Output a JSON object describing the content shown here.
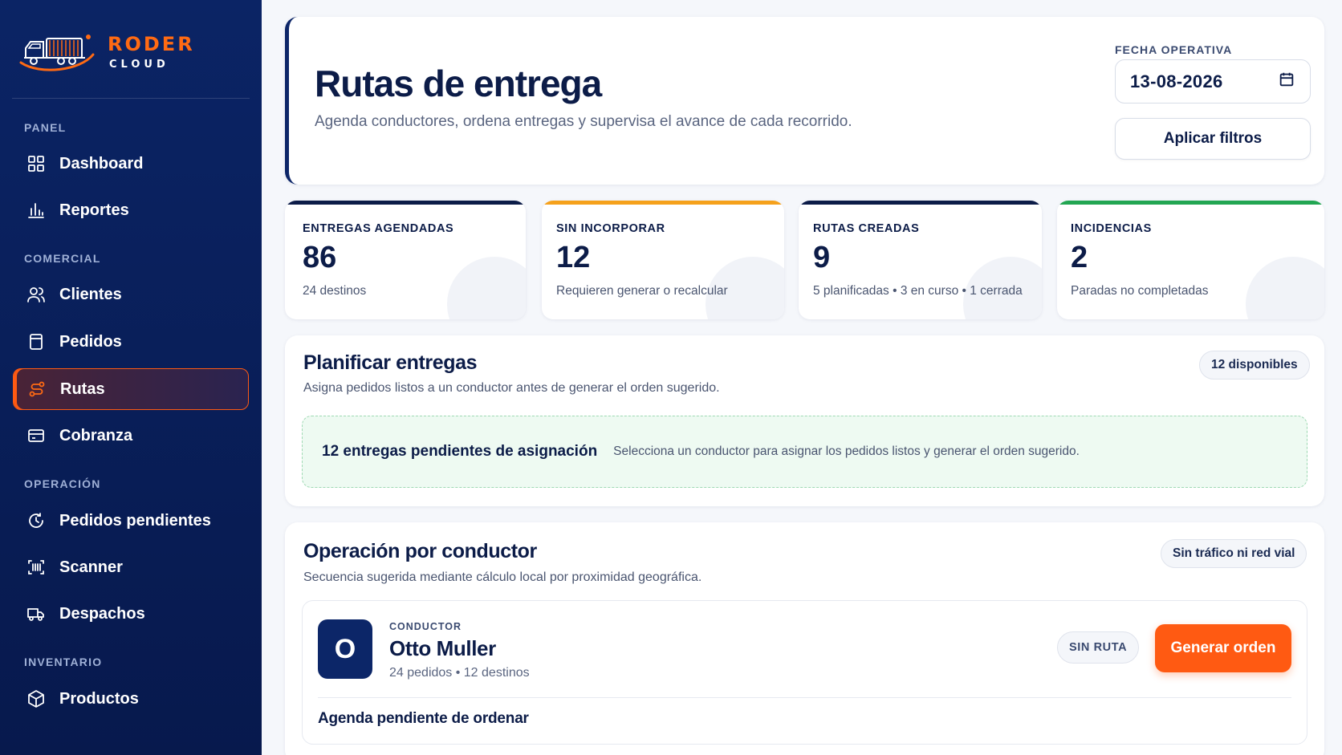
{
  "brand": {
    "name": "RODER",
    "sub": "CLOUD"
  },
  "sidebar": {
    "sections": [
      {
        "label": "PANEL"
      },
      {
        "label": "COMERCIAL"
      },
      {
        "label": "OPERACIÓN"
      },
      {
        "label": "INVENTARIO"
      }
    ],
    "items": [
      {
        "label": "Dashboard",
        "icon": "grid-icon"
      },
      {
        "label": "Reportes",
        "icon": "bar-chart-icon"
      },
      {
        "label": "Clientes",
        "icon": "users-icon"
      },
      {
        "label": "Pedidos",
        "icon": "clipboard-icon"
      },
      {
        "label": "Rutas",
        "icon": "route-icon",
        "active": true
      },
      {
        "label": "Cobranza",
        "icon": "wallet-icon"
      },
      {
        "label": "Pedidos pendientes",
        "icon": "clock-icon"
      },
      {
        "label": "Scanner",
        "icon": "scanner-icon"
      },
      {
        "label": "Despachos",
        "icon": "truck-icon"
      },
      {
        "label": "Productos",
        "icon": "box-icon"
      }
    ]
  },
  "header": {
    "title": "Rutas de entrega",
    "subtitle": "Agenda conductores, ordena entregas y supervisa el avance de cada recorrido.",
    "date_label": "FECHA OPERATIVA",
    "date_value": "13-08-2026",
    "apply_label": "Aplicar filtros"
  },
  "stats": [
    {
      "label": "ENTREGAS AGENDADAS",
      "value": "86",
      "sub": "24 destinos",
      "color": "#0c1c48"
    },
    {
      "label": "SIN INCORPORAR",
      "value": "12",
      "sub": "Requieren generar o recalcular",
      "color": "#f5a11c"
    },
    {
      "label": "RUTAS CREADAS",
      "value": "9",
      "sub": "5 planificadas • 3 en curso • 1 cerrada",
      "color": "#0c1c48"
    },
    {
      "label": "INCIDENCIAS",
      "value": "2",
      "sub": "Paradas no completadas",
      "color": "#22a652"
    }
  ],
  "plan": {
    "title": "Planificar entregas",
    "subtitle": "Asigna pedidos listos a un conductor antes de generar el orden sugerido.",
    "badge": "12 disponibles",
    "pending_title": "12 entregas pendientes de asignación",
    "pending_text": "Selecciona un conductor para asignar los pedidos listos y generar el orden sugerido."
  },
  "operation": {
    "title": "Operación por conductor",
    "subtitle": "Secuencia sugerida mediante cálculo local por proximidad geográfica.",
    "badge": "Sin tráfico ni red vial",
    "driver": {
      "initial": "O",
      "role": "CONDUCTOR",
      "name": "Otto Muller",
      "meta": "24 pedidos • 12 destinos",
      "status": "SIN RUTA",
      "action": "Generar orden",
      "agenda_title": "Agenda pendiente de ordenar"
    }
  },
  "colors": {
    "accent": "#ff5a12",
    "navy": "#0b2465"
  }
}
